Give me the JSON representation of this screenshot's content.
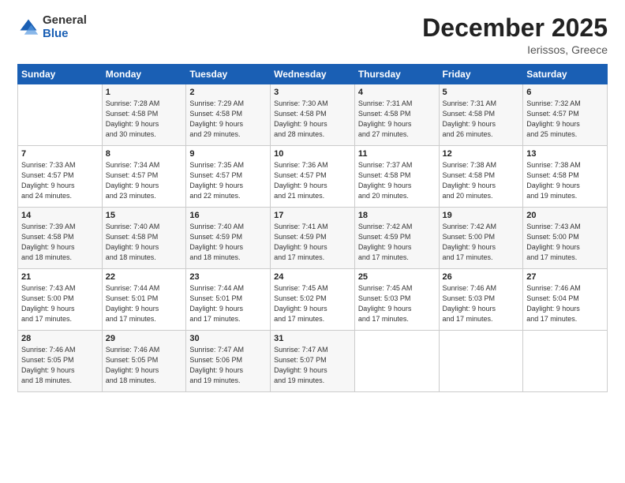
{
  "logo": {
    "general": "General",
    "blue": "Blue"
  },
  "title": "December 2025",
  "location": "Ierissos, Greece",
  "days_header": [
    "Sunday",
    "Monday",
    "Tuesday",
    "Wednesday",
    "Thursday",
    "Friday",
    "Saturday"
  ],
  "weeks": [
    [
      {
        "day": "",
        "info": ""
      },
      {
        "day": "1",
        "info": "Sunrise: 7:28 AM\nSunset: 4:58 PM\nDaylight: 9 hours\nand 30 minutes."
      },
      {
        "day": "2",
        "info": "Sunrise: 7:29 AM\nSunset: 4:58 PM\nDaylight: 9 hours\nand 29 minutes."
      },
      {
        "day": "3",
        "info": "Sunrise: 7:30 AM\nSunset: 4:58 PM\nDaylight: 9 hours\nand 28 minutes."
      },
      {
        "day": "4",
        "info": "Sunrise: 7:31 AM\nSunset: 4:58 PM\nDaylight: 9 hours\nand 27 minutes."
      },
      {
        "day": "5",
        "info": "Sunrise: 7:31 AM\nSunset: 4:58 PM\nDaylight: 9 hours\nand 26 minutes."
      },
      {
        "day": "6",
        "info": "Sunrise: 7:32 AM\nSunset: 4:57 PM\nDaylight: 9 hours\nand 25 minutes."
      }
    ],
    [
      {
        "day": "7",
        "info": "Sunrise: 7:33 AM\nSunset: 4:57 PM\nDaylight: 9 hours\nand 24 minutes."
      },
      {
        "day": "8",
        "info": "Sunrise: 7:34 AM\nSunset: 4:57 PM\nDaylight: 9 hours\nand 23 minutes."
      },
      {
        "day": "9",
        "info": "Sunrise: 7:35 AM\nSunset: 4:57 PM\nDaylight: 9 hours\nand 22 minutes."
      },
      {
        "day": "10",
        "info": "Sunrise: 7:36 AM\nSunset: 4:57 PM\nDaylight: 9 hours\nand 21 minutes."
      },
      {
        "day": "11",
        "info": "Sunrise: 7:37 AM\nSunset: 4:58 PM\nDaylight: 9 hours\nand 20 minutes."
      },
      {
        "day": "12",
        "info": "Sunrise: 7:38 AM\nSunset: 4:58 PM\nDaylight: 9 hours\nand 20 minutes."
      },
      {
        "day": "13",
        "info": "Sunrise: 7:38 AM\nSunset: 4:58 PM\nDaylight: 9 hours\nand 19 minutes."
      }
    ],
    [
      {
        "day": "14",
        "info": "Sunrise: 7:39 AM\nSunset: 4:58 PM\nDaylight: 9 hours\nand 18 minutes."
      },
      {
        "day": "15",
        "info": "Sunrise: 7:40 AM\nSunset: 4:58 PM\nDaylight: 9 hours\nand 18 minutes."
      },
      {
        "day": "16",
        "info": "Sunrise: 7:40 AM\nSunset: 4:59 PM\nDaylight: 9 hours\nand 18 minutes."
      },
      {
        "day": "17",
        "info": "Sunrise: 7:41 AM\nSunset: 4:59 PM\nDaylight: 9 hours\nand 17 minutes."
      },
      {
        "day": "18",
        "info": "Sunrise: 7:42 AM\nSunset: 4:59 PM\nDaylight: 9 hours\nand 17 minutes."
      },
      {
        "day": "19",
        "info": "Sunrise: 7:42 AM\nSunset: 5:00 PM\nDaylight: 9 hours\nand 17 minutes."
      },
      {
        "day": "20",
        "info": "Sunrise: 7:43 AM\nSunset: 5:00 PM\nDaylight: 9 hours\nand 17 minutes."
      }
    ],
    [
      {
        "day": "21",
        "info": "Sunrise: 7:43 AM\nSunset: 5:00 PM\nDaylight: 9 hours\nand 17 minutes."
      },
      {
        "day": "22",
        "info": "Sunrise: 7:44 AM\nSunset: 5:01 PM\nDaylight: 9 hours\nand 17 minutes."
      },
      {
        "day": "23",
        "info": "Sunrise: 7:44 AM\nSunset: 5:01 PM\nDaylight: 9 hours\nand 17 minutes."
      },
      {
        "day": "24",
        "info": "Sunrise: 7:45 AM\nSunset: 5:02 PM\nDaylight: 9 hours\nand 17 minutes."
      },
      {
        "day": "25",
        "info": "Sunrise: 7:45 AM\nSunset: 5:03 PM\nDaylight: 9 hours\nand 17 minutes."
      },
      {
        "day": "26",
        "info": "Sunrise: 7:46 AM\nSunset: 5:03 PM\nDaylight: 9 hours\nand 17 minutes."
      },
      {
        "day": "27",
        "info": "Sunrise: 7:46 AM\nSunset: 5:04 PM\nDaylight: 9 hours\nand 17 minutes."
      }
    ],
    [
      {
        "day": "28",
        "info": "Sunrise: 7:46 AM\nSunset: 5:05 PM\nDaylight: 9 hours\nand 18 minutes."
      },
      {
        "day": "29",
        "info": "Sunrise: 7:46 AM\nSunset: 5:05 PM\nDaylight: 9 hours\nand 18 minutes."
      },
      {
        "day": "30",
        "info": "Sunrise: 7:47 AM\nSunset: 5:06 PM\nDaylight: 9 hours\nand 19 minutes."
      },
      {
        "day": "31",
        "info": "Sunrise: 7:47 AM\nSunset: 5:07 PM\nDaylight: 9 hours\nand 19 minutes."
      },
      {
        "day": "",
        "info": ""
      },
      {
        "day": "",
        "info": ""
      },
      {
        "day": "",
        "info": ""
      }
    ]
  ]
}
